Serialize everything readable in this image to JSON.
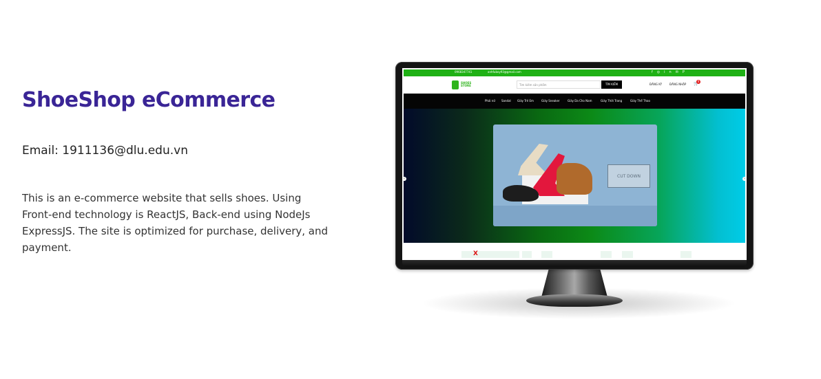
{
  "project": {
    "title": "ShoeShop eCommerce",
    "email": "Email: 1911136@dlu.edu.vn",
    "description_lines": [
      "This is an e-commerce website that sells shoes. Using",
      "Front-end technology is ReactJS, Back-end using NodeJs",
      "ExpressJS. The site is optimized for purchase, delivery, and",
      "payment."
    ]
  },
  "preview": {
    "topbar": {
      "phone": "0968347741",
      "email": "anhfuboy93@gmail.com",
      "social_icons": [
        "facebook-icon",
        "instagram-icon",
        "linkedin-icon",
        "mail-icon",
        "pinterest-icon"
      ]
    },
    "header": {
      "logo_line1": "SHOES",
      "logo_line2": "STORE",
      "search_placeholder": "Tìm kiếm sản phẩm",
      "search_button": "TÌM KIẾM",
      "register": "ĐĂNG KÝ",
      "login": "ĐĂNG NHẬP",
      "cart_count": "0"
    },
    "nav": [
      "Phái nữ",
      "Sandal",
      "Giày Trẻ Em",
      "Giày Sneaker",
      "Giày Da Cho Nam",
      "Giày Thời Trang",
      "Giày Thể Thao"
    ],
    "hero": {
      "sign_text": "CUT DOWN"
    },
    "colors": {
      "title": "#3a2596",
      "topbar": "#1fb115",
      "nav": "#050505"
    }
  }
}
